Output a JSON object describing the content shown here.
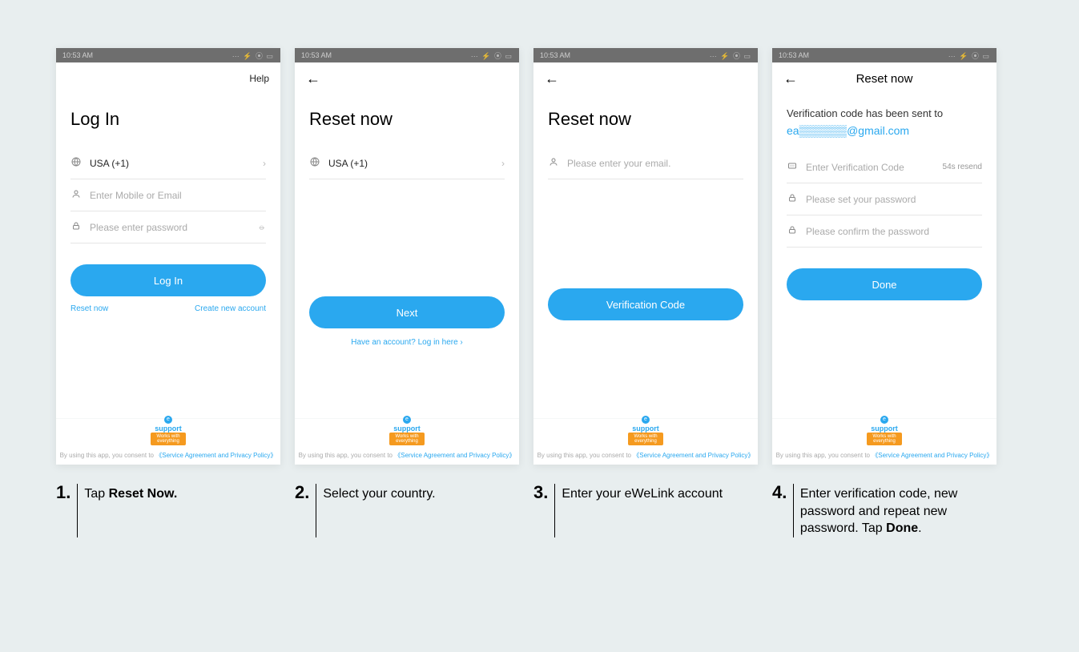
{
  "statusbar": {
    "time": "10:53 AM",
    "icons": "⋯ ⚡ ⦿ ▭"
  },
  "common": {
    "policy_prefix": "By using this app, you consent to ",
    "policy_link": "《Service Agreement and Privacy Policy》",
    "support_top": "support",
    "support_tag": "Works with everything"
  },
  "s1": {
    "help": "Help",
    "title": "Log In",
    "country": "USA (+1)",
    "ph_user": "Enter Mobile or Email",
    "ph_pass": "Please enter password",
    "btn": "Log In",
    "reset": "Reset now",
    "create": "Create new account"
  },
  "s2": {
    "title": "Reset now",
    "country": "USA (+1)",
    "btn": "Next",
    "login_here": "Have an account? Log in here ›"
  },
  "s3": {
    "title": "Reset now",
    "ph_email": "Please enter your email.",
    "btn": "Verification Code"
  },
  "s4": {
    "title": "Reset now",
    "msg": "Verification code has been sent to",
    "email": "ea▒▒▒▒▒▒@gmail.com",
    "ph_code": "Enter Verification Code",
    "resend": "54s resend",
    "ph_pass1": "Please set your password",
    "ph_pass2": "Please confirm the password",
    "btn": "Done"
  },
  "cap1": {
    "n": "1.",
    "pre": "Tap ",
    "bold": "Reset Now."
  },
  "cap2": {
    "n": "2.",
    "txt": "Select your country."
  },
  "cap3": {
    "n": "3.",
    "txt": "Enter your eWeLink account"
  },
  "cap4": {
    "n": "4.",
    "pre": "Enter verification code, new password and repeat new password. Tap ",
    "bold": "Done",
    "post": "."
  }
}
